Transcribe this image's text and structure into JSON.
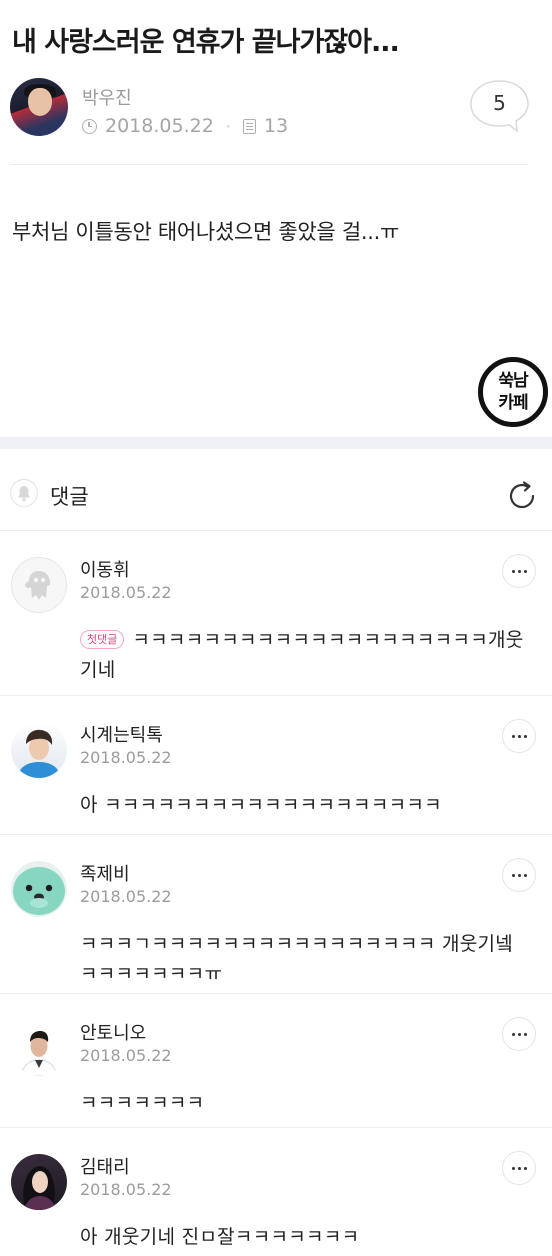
{
  "post": {
    "title": "내 사랑스러운 연휴가 끝나가잖아...",
    "author": "박우진",
    "date": "2018.05.22",
    "views": "13",
    "comment_count": "5",
    "body": "부처님 이틀동안 태어나셨으면 좋았을 걸...ㅠ",
    "logo_lines": [
      "쑥남",
      "카페"
    ]
  },
  "comments_section": {
    "label": "댓글"
  },
  "comments": [
    {
      "name": "이동휘",
      "date": "2018.05.22",
      "badge": "첫댓글",
      "text": "ㅋㅋㅋㅋㅋㅋㅋㅋㅋㅋㅋㅋㅋㅋㅋㅋㅋㅋㅋㅋ개웃기네"
    },
    {
      "name": "시계는틱톡",
      "date": "2018.05.22",
      "text": "아 ㅋㅋㅋㅋㅋㅋㅋㅋㅋㅋㅋㅋㅋㅋㅋㅋㅋㅋㅋ"
    },
    {
      "name": "족제비",
      "date": "2018.05.22",
      "text": "ㅋㅋㅋㄱㅋㅋㅋㅋㅋㅋㅋㅋㅋㅋㅋㅋㅋㅋㅋㅋ 개웃기넼ㅋㅋㅋㅋㅋㅋㅋㅠ"
    },
    {
      "name": "안토니오",
      "date": "2018.05.22",
      "text": "ㅋㅋㅋㅋㅋㅋㅋ"
    },
    {
      "name": "김태리",
      "date": "2018.05.22",
      "text": "아 개웃기네 진ㅁ잘ㅋㅋㅋㅋㅋㅋㅋ"
    }
  ],
  "icons": {
    "clock": "clock-icon",
    "views": "document-icon",
    "comment": "speech-bubble-icon",
    "bell": "bell-icon",
    "refresh": "refresh-icon",
    "more": "more-options-icon"
  },
  "colors": {
    "badge_pink": "#e0457b",
    "muted_text": "#9c9c9c",
    "section_band": "#eef0f4"
  }
}
